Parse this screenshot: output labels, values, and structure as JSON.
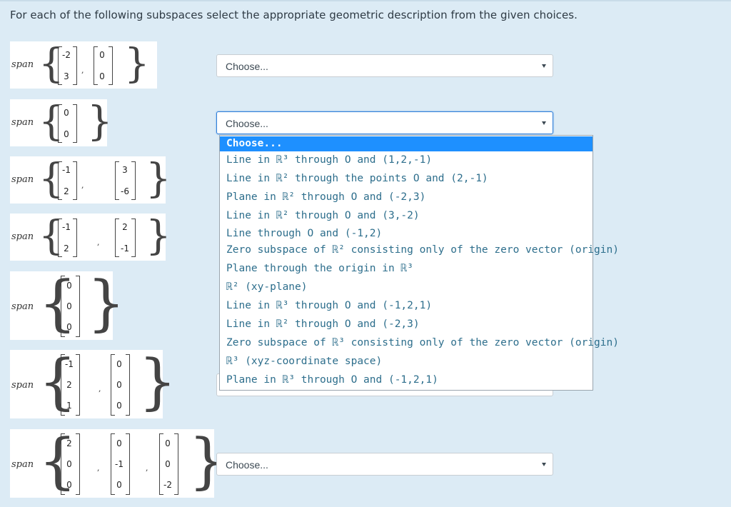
{
  "prompt": "For each of the following subspaces select the appropriate geometric description from the given choices.",
  "span_word": "span",
  "questions": [
    {
      "vectors": [
        [
          "-2",
          "3"
        ],
        [
          "0",
          "0"
        ]
      ],
      "answer": "Choose..."
    },
    {
      "vectors": [
        [
          "0",
          "0"
        ]
      ],
      "answer": "Choose..."
    },
    {
      "vectors": [
        [
          "-1",
          "2"
        ],
        [
          "3",
          "-6"
        ]
      ],
      "answer": ""
    },
    {
      "vectors": [
        [
          "-1",
          "2"
        ],
        [
          "2",
          "-1"
        ]
      ],
      "answer": ""
    },
    {
      "vectors": [
        [
          "0",
          "0",
          "0"
        ]
      ],
      "answer": ""
    },
    {
      "vectors": [
        [
          "-1",
          "2",
          "1"
        ],
        [
          "0",
          "0",
          "0"
        ]
      ],
      "answer": ""
    },
    {
      "vectors": [
        [
          "2",
          "0",
          "0"
        ],
        [
          "0",
          "-1",
          "0"
        ],
        [
          "0",
          "0",
          "-2"
        ]
      ],
      "answer": "Choose..."
    }
  ],
  "dropdown_options": [
    "Choose...",
    "Line in ℝ³ through O and (1,2,-1)",
    "Line in ℝ² through the points O and (2,-1)",
    "Plane in ℝ² through O and (-2,3)",
    "Line in ℝ² through O and (3,-2)",
    "Line through O and (-1,2)",
    "Zero subspace of ℝ² consisting only of the zero vector (origin)",
    "Plane through the origin in ℝ³",
    "ℝ² (xy-plane)",
    "Line in ℝ³ through O and (-1,2,1)",
    "Line in ℝ² through O and (-2,3)",
    "Zero subspace of ℝ³ consisting only of the zero vector (origin)",
    "ℝ³ (xyz-coordinate space)",
    "Plane in ℝ³ through O and (-1,2,1)"
  ],
  "colors": {
    "background": "#dcebf5",
    "highlight": "#1e90ff",
    "option_text": "#2d6e8c"
  }
}
